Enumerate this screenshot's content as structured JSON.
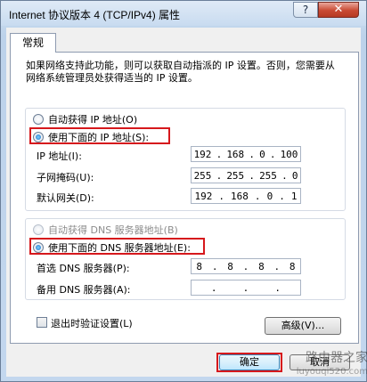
{
  "window": {
    "title": "Internet 协议版本 4 (TCP/IPv4) 属性",
    "help_label": "?",
    "close_label": "✕"
  },
  "tabs": [
    {
      "label": "常规"
    }
  ],
  "description": "如果网络支持此功能，则可以获取自动指派的 IP 设置。否则，您需要从网络系统管理员处获得适当的 IP 设置。",
  "ip_section": {
    "auto_label": "自动获得 IP 地址(O)",
    "manual_label": "使用下面的 IP 地址(S):",
    "selected": "manual",
    "fields": [
      {
        "label": "IP 地址(I):",
        "octets": [
          "192",
          "168",
          "0",
          "100"
        ]
      },
      {
        "label": "子网掩码(U):",
        "octets": [
          "255",
          "255",
          "255",
          "0"
        ]
      },
      {
        "label": "默认网关(D):",
        "octets": [
          "192",
          "168",
          "0",
          "1"
        ]
      }
    ]
  },
  "dns_section": {
    "auto_label": "自动获得 DNS 服务器地址(B)",
    "manual_label": "使用下面的 DNS 服务器地址(E):",
    "selected": "manual",
    "fields": [
      {
        "label": "首选 DNS 服务器(P):",
        "octets": [
          "8",
          "8",
          "8",
          "8"
        ]
      },
      {
        "label": "备用 DNS 服务器(A):",
        "octets": [
          "",
          "",
          "",
          ""
        ]
      }
    ]
  },
  "validate_checkbox": {
    "label": "退出时验证设置(L)",
    "checked": false
  },
  "advanced_button": "高级(V)...",
  "ok_button": "确定",
  "cancel_button": "取消",
  "watermark": {
    "line1": "路由器之家",
    "line2": "luyouqi520.com"
  },
  "colors": {
    "highlight": "#d6181c",
    "title_bg": "#c8dbf0",
    "close_button": "#c94a33"
  }
}
